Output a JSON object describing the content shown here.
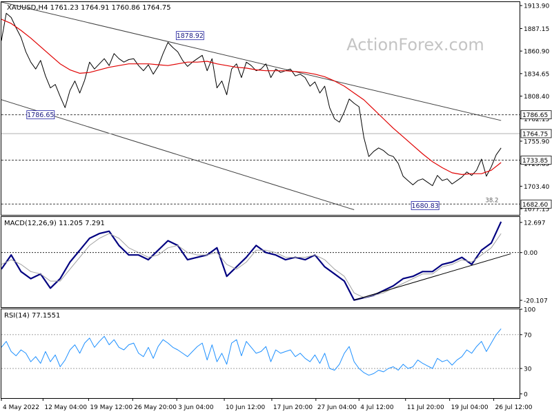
{
  "watermark": "ActionForex.com",
  "chart_data": [
    {
      "type": "line",
      "panel": "price",
      "header": "XAUUSD,H4 1761.23 1764.91 1760.86 1764.75",
      "ylim": [
        1670,
        1918
      ],
      "y_ticks": [
        {
          "value": 1913.9,
          "label": "1913.90"
        },
        {
          "value": 1887.15,
          "label": "1887.15"
        },
        {
          "value": 1860.9,
          "label": "1860.90"
        },
        {
          "value": 1834.65,
          "label": "1834.65"
        },
        {
          "value": 1808.4,
          "label": "1808.40"
        },
        {
          "value": 1782.15,
          "label": "1782.15"
        },
        {
          "value": 1755.9,
          "label": "1755.90"
        },
        {
          "value": 1729.65,
          "label": "1729.65"
        },
        {
          "value": 1703.4,
          "label": "1703.40"
        },
        {
          "value": 1677.15,
          "label": "1677.15"
        }
      ],
      "x_range": [
        0,
        100
      ],
      "x_ticks": [
        {
          "x": 0,
          "label": "4 May 2022"
        },
        {
          "x": 8.5,
          "label": "12 May 04:00"
        },
        {
          "x": 17.8,
          "label": "19 May 12:00"
        },
        {
          "x": 26.8,
          "label": "26 May 20:00"
        },
        {
          "x": 35.8,
          "label": "3 Jun 04:00"
        },
        {
          "x": 45.5,
          "label": "10 Jun 12:00"
        },
        {
          "x": 55.2,
          "label": "17 Jun 20:00"
        },
        {
          "x": 64.2,
          "label": "27 Jun 04:00"
        },
        {
          "x": 73,
          "label": "4 Jul 12:00"
        },
        {
          "x": 82.5,
          "label": "11 Jul 20:00"
        },
        {
          "x": 91.5,
          "label": "19 Jul 04:00"
        },
        {
          "x": 100.5,
          "label": "26 Jul 12:00"
        }
      ],
      "series": [
        {
          "color": "#000000",
          "x": [
            0,
            1,
            2,
            3,
            4,
            5,
            6,
            7,
            8,
            9,
            10,
            11,
            12,
            13,
            14,
            15,
            16,
            17,
            18,
            19,
            20,
            21,
            22,
            23,
            24,
            25,
            26,
            27,
            28,
            29,
            30,
            31,
            32,
            33,
            34,
            35,
            36,
            37,
            38,
            39,
            40,
            41,
            42,
            43,
            44,
            45,
            46,
            47,
            48,
            49,
            50,
            51,
            52,
            53,
            54,
            55,
            56,
            57,
            58,
            59,
            60,
            61,
            62,
            63,
            64,
            65,
            66,
            67,
            68,
            69,
            70,
            71,
            72,
            73,
            74,
            75,
            76,
            77,
            78,
            79,
            80,
            81,
            82,
            83,
            84,
            85,
            86,
            87,
            88,
            89,
            90,
            91,
            92,
            93,
            94,
            95,
            96,
            97,
            98,
            99,
            100,
            101,
            102
          ],
          "values": [
            1873,
            1905,
            1900,
            1888,
            1877,
            1860,
            1848,
            1840,
            1850,
            1832,
            1818,
            1822,
            1808,
            1795,
            1815,
            1826,
            1812,
            1827,
            1848,
            1840,
            1846,
            1852,
            1844,
            1858,
            1852,
            1848,
            1851,
            1852,
            1844,
            1838,
            1845,
            1834,
            1843,
            1858,
            1871,
            1865,
            1860,
            1850,
            1843,
            1848,
            1852,
            1856,
            1838,
            1852,
            1818,
            1826,
            1810,
            1840,
            1846,
            1830,
            1848,
            1844,
            1838,
            1840,
            1846,
            1830,
            1840,
            1836,
            1838,
            1840,
            1832,
            1834,
            1830,
            1820,
            1825,
            1812,
            1820,
            1795,
            1782,
            1778,
            1790,
            1805,
            1800,
            1796,
            1760,
            1738,
            1744,
            1748,
            1745,
            1740,
            1738,
            1730,
            1715,
            1710,
            1705,
            1710,
            1712,
            1708,
            1704,
            1716,
            1710,
            1712,
            1706,
            1710,
            1714,
            1720,
            1716,
            1722,
            1735,
            1715,
            1726,
            1740,
            1748
          ]
        },
        {
          "color": "#e00000",
          "x": [
            0,
            2,
            4,
            6,
            8,
            10,
            12,
            14,
            16,
            18,
            20,
            22,
            24,
            26,
            28,
            30,
            32,
            34,
            36,
            38,
            40,
            42,
            44,
            46,
            48,
            50,
            52,
            54,
            56,
            58,
            60,
            62,
            64,
            66,
            68,
            70,
            72,
            74,
            76,
            78,
            80,
            82,
            84,
            86,
            88,
            90,
            92,
            94,
            96,
            98,
            100,
            102
          ],
          "values": [
            1898,
            1893,
            1885,
            1876,
            1866,
            1856,
            1846,
            1839,
            1835,
            1836,
            1839,
            1842,
            1844,
            1846,
            1846,
            1846,
            1845,
            1844,
            1846,
            1848,
            1848,
            1849,
            1846,
            1844,
            1842,
            1841,
            1839,
            1838,
            1838,
            1838,
            1837,
            1836,
            1834,
            1831,
            1826,
            1820,
            1812,
            1804,
            1793,
            1782,
            1771,
            1761,
            1751,
            1741,
            1732,
            1725,
            1719,
            1717,
            1718,
            1718,
            1722,
            1731
          ]
        }
      ],
      "channel_lines": [
        {
          "color": "#404040",
          "points": [
            [
              0,
              1918
            ],
            [
              102,
              1780
            ]
          ]
        },
        {
          "color": "#404040",
          "points": [
            [
              -1,
              1806
            ],
            [
              72,
              1676
            ]
          ]
        }
      ],
      "hlines": [
        {
          "value": 1786.65,
          "label": "1786.65",
          "style": "dashed",
          "color": "#404040",
          "label_bg": "#ffffff"
        },
        {
          "value": 1764.75,
          "label": "1764.75",
          "style": "solid",
          "color": "#b0b0b0",
          "label_bg": "#ffffff"
        },
        {
          "value": 1733.85,
          "label": "1733.85",
          "style": "dashed",
          "color": "#404040",
          "label_bg": "#ffffff"
        },
        {
          "value": 1682.6,
          "label": "1682.60",
          "style": "dashed",
          "color": "#404040",
          "label_bg": "#ffffff"
        }
      ],
      "annotations": [
        {
          "label": "1786.65",
          "x": 8,
          "value": 1786.65,
          "boxed": true
        },
        {
          "label": "1878.92",
          "x": 38.5,
          "value": 1878.92,
          "boxed": true
        },
        {
          "label": "1680.83",
          "x": 86.5,
          "value": 1680.83,
          "boxed": true
        },
        {
          "label": "38.2",
          "x": 99,
          "value": 1682.6,
          "boxed": false
        }
      ]
    },
    {
      "type": "line",
      "panel": "macd",
      "header": "MACD(12,26,9) 11.205 7.291",
      "ylim": [
        -23,
        15
      ],
      "y_ticks": [
        {
          "value": 12.697,
          "label": "12.697"
        },
        {
          "value": 0,
          "label": "0.00"
        },
        {
          "value": -20.107,
          "label": "-20.107"
        }
      ],
      "zero_line": true,
      "series": [
        {
          "color": "#000080",
          "x": [
            0,
            2,
            4,
            6,
            8,
            10,
            12,
            14,
            16,
            18,
            20,
            22,
            24,
            26,
            28,
            30,
            32,
            34,
            36,
            38,
            40,
            42,
            44,
            46,
            48,
            50,
            52,
            54,
            56,
            58,
            60,
            62,
            64,
            66,
            68,
            70,
            72,
            74,
            76,
            78,
            80,
            82,
            84,
            86,
            88,
            90,
            92,
            94,
            96,
            98,
            100,
            102
          ],
          "values": [
            -7,
            -1,
            -8,
            -11,
            -9,
            -15,
            -11,
            -4,
            1,
            6,
            8,
            9,
            3,
            -1,
            -1,
            -3,
            1,
            5,
            3,
            -3,
            -2,
            -1,
            2,
            -10,
            -6,
            -2,
            3,
            0,
            -1,
            -3,
            -2,
            -3,
            -1,
            -6,
            -9,
            -12,
            -20,
            -19,
            -18,
            -16,
            -14,
            -11,
            -10,
            -8,
            -8,
            -5,
            -4,
            -2,
            -5,
            1,
            4,
            13
          ]
        },
        {
          "color": "#a0a0a0",
          "x": [
            0,
            2,
            4,
            6,
            8,
            10,
            12,
            14,
            16,
            18,
            20,
            22,
            24,
            26,
            28,
            30,
            32,
            34,
            36,
            38,
            40,
            42,
            44,
            46,
            48,
            50,
            52,
            54,
            56,
            58,
            60,
            62,
            64,
            66,
            68,
            70,
            72,
            74,
            76,
            78,
            80,
            82,
            84,
            86,
            88,
            90,
            92,
            94,
            96,
            98,
            100,
            102
          ],
          "values": [
            -5,
            -3,
            -5,
            -8,
            -9,
            -12,
            -12,
            -7,
            -2,
            3,
            6,
            8,
            6,
            2,
            0,
            -2,
            -1,
            2,
            3,
            0,
            -1,
            -1,
            0,
            -5,
            -7,
            -4,
            1,
            1,
            0,
            -2,
            -2,
            -2,
            -1,
            -3,
            -7,
            -10,
            -17,
            -19,
            -18,
            -17,
            -15,
            -13,
            -11,
            -9,
            -9,
            -6,
            -5,
            -3,
            -4,
            -1,
            2,
            8
          ]
        }
      ],
      "trendline": {
        "color": "#000000",
        "points": [
          [
            72,
            -20
          ],
          [
            104,
            -0.5
          ]
        ]
      }
    },
    {
      "type": "line",
      "panel": "rsi",
      "header": "RSI(14) 77.1551",
      "ylim": [
        -5,
        100
      ],
      "y_ticks": [
        {
          "value": 100,
          "label": "100"
        },
        {
          "value": 70,
          "label": "70"
        },
        {
          "value": 30,
          "label": "30"
        },
        {
          "value": 0,
          "label": "0"
        }
      ],
      "hlines": [
        {
          "value": 70
        },
        {
          "value": 30
        }
      ],
      "series": [
        {
          "color": "#1e90ff",
          "x": [
            0,
            1,
            2,
            3,
            4,
            5,
            6,
            7,
            8,
            9,
            10,
            11,
            12,
            13,
            14,
            15,
            16,
            17,
            18,
            19,
            20,
            21,
            22,
            23,
            24,
            25,
            26,
            27,
            28,
            29,
            30,
            31,
            32,
            33,
            34,
            35,
            36,
            37,
            38,
            39,
            40,
            41,
            42,
            43,
            44,
            45,
            46,
            47,
            48,
            49,
            50,
            51,
            52,
            53,
            54,
            55,
            56,
            57,
            58,
            59,
            60,
            61,
            62,
            63,
            64,
            65,
            66,
            67,
            68,
            69,
            70,
            71,
            72,
            73,
            74,
            75,
            76,
            77,
            78,
            79,
            80,
            81,
            82,
            83,
            84,
            85,
            86,
            87,
            88,
            89,
            90,
            91,
            92,
            93,
            94,
            95,
            96,
            97,
            98,
            99,
            100,
            101,
            102
          ],
          "values": [
            55,
            62,
            50,
            45,
            52,
            48,
            38,
            44,
            36,
            50,
            38,
            46,
            32,
            40,
            52,
            58,
            48,
            60,
            66,
            55,
            62,
            68,
            58,
            64,
            55,
            52,
            58,
            60,
            48,
            44,
            55,
            42,
            56,
            64,
            60,
            55,
            52,
            48,
            44,
            50,
            56,
            60,
            40,
            58,
            38,
            48,
            35,
            60,
            64,
            45,
            62,
            55,
            48,
            50,
            56,
            38,
            52,
            48,
            50,
            52,
            44,
            48,
            42,
            38,
            46,
            36,
            48,
            30,
            28,
            35,
            48,
            56,
            38,
            30,
            25,
            22,
            24,
            28,
            26,
            30,
            32,
            28,
            35,
            30,
            32,
            40,
            36,
            33,
            30,
            42,
            38,
            40,
            34,
            40,
            44,
            52,
            48,
            56,
            62,
            50,
            60,
            70,
            77
          ]
        }
      ]
    }
  ]
}
